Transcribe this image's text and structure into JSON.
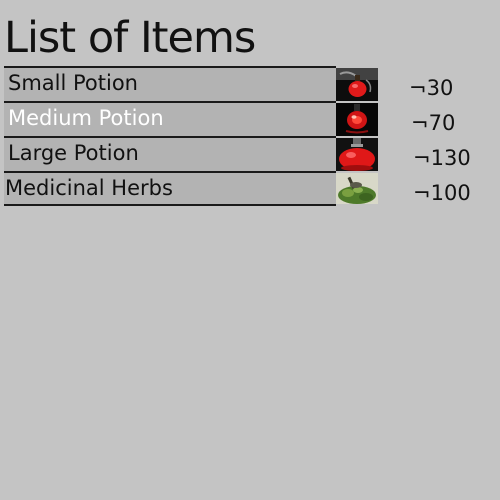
{
  "title": "List of Items",
  "items": [
    {
      "name": "Small Potion",
      "price": "¬30",
      "icon": "small-potion-icon",
      "selected": false
    },
    {
      "name": "Medium Potion",
      "price": "¬70",
      "icon": "medium-potion-icon",
      "selected": true
    },
    {
      "name": "Large Potion",
      "price": "¬130",
      "icon": "large-potion-icon",
      "selected": false
    },
    {
      "name": "Medicinal Herbs",
      "price": "¬100",
      "icon": "medicinal-herbs-icon",
      "selected": false
    }
  ],
  "colors": {
    "background": "#c4c4c4",
    "row_bar": "#b3b3b3",
    "selected_text": "#ffffff",
    "potion_red": "#e01a1a"
  }
}
